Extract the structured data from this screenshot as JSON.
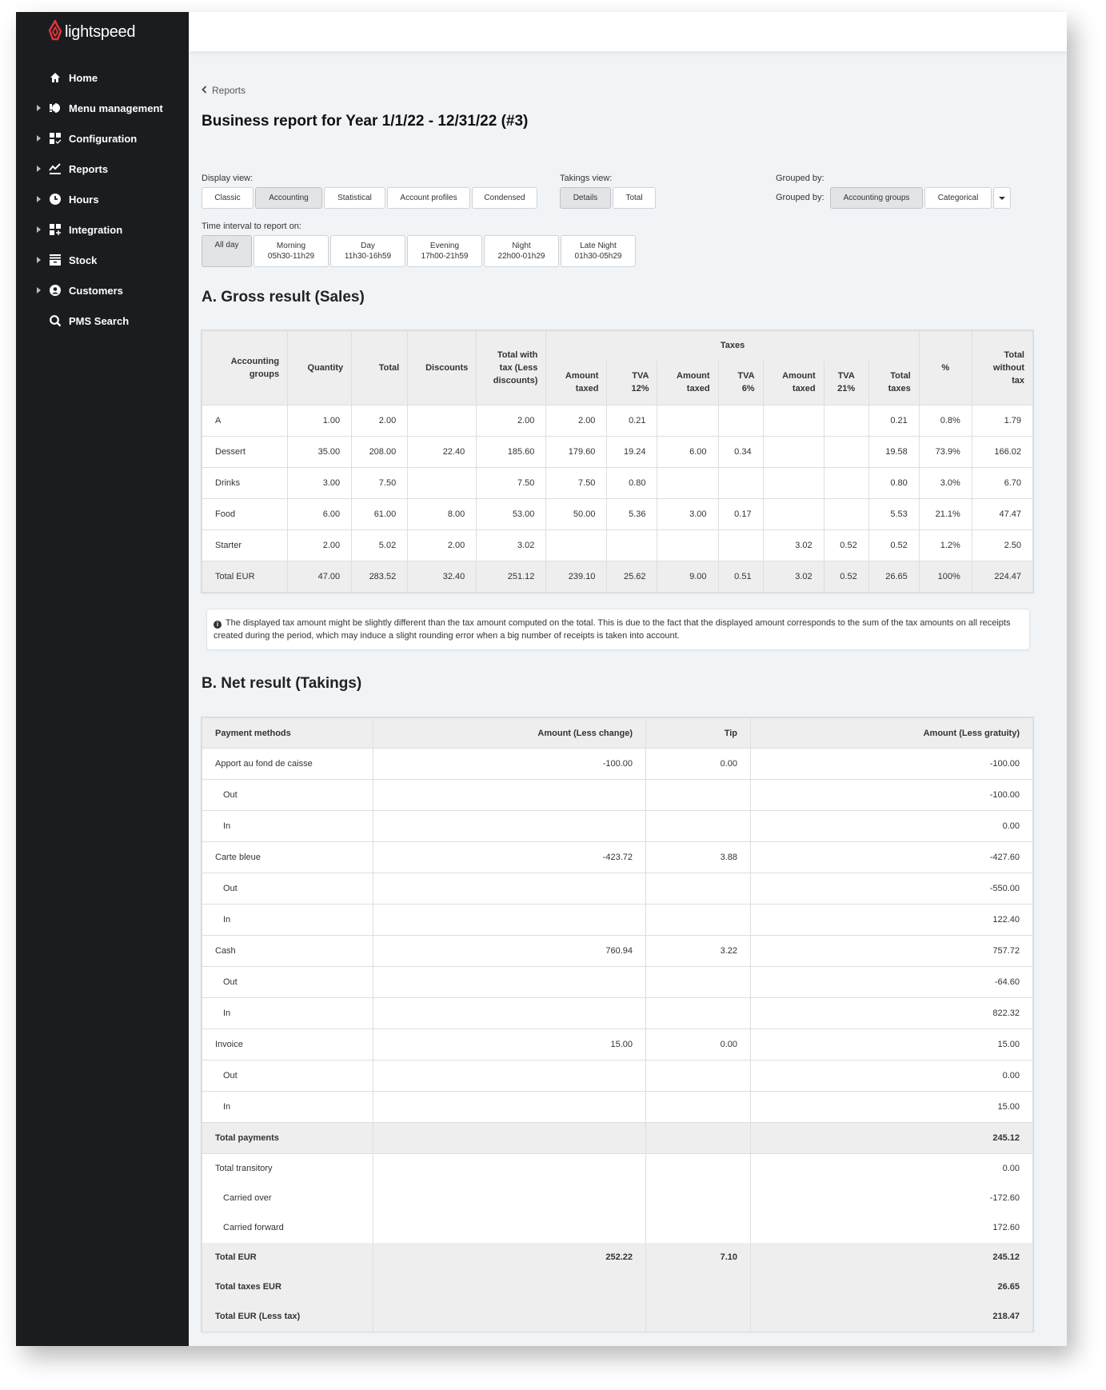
{
  "app": {
    "brand": "lightspeed",
    "brand_color": "#e4343c"
  },
  "sidebar": {
    "items": [
      {
        "label": "Home",
        "icon": "home-icon",
        "expandable": false
      },
      {
        "label": "Menu management",
        "icon": "menu-management-icon",
        "expandable": true
      },
      {
        "label": "Configuration",
        "icon": "configuration-icon",
        "expandable": true
      },
      {
        "label": "Reports",
        "icon": "reports-icon",
        "expandable": true
      },
      {
        "label": "Hours",
        "icon": "clock-icon",
        "expandable": true
      },
      {
        "label": "Integration",
        "icon": "integration-icon",
        "expandable": true
      },
      {
        "label": "Stock",
        "icon": "stock-icon",
        "expandable": true
      },
      {
        "label": "Customers",
        "icon": "user-icon",
        "expandable": true
      },
      {
        "label": "PMS Search",
        "icon": "search-icon",
        "expandable": false
      }
    ]
  },
  "breadcrumb": {
    "back_label": "Reports"
  },
  "page_title": "Business report for Year 1/1/22 - 12/31/22 (#3)",
  "controls": {
    "display_view": {
      "label": "Display view:",
      "options": [
        "Classic",
        "Accounting",
        "Statistical",
        "Account profiles",
        "Condensed"
      ],
      "selected": "Accounting"
    },
    "takings_view": {
      "label": "Takings view:",
      "options": [
        "Details",
        "Total"
      ],
      "selected": "Details"
    },
    "grouped_by": {
      "heading": "Grouped by:",
      "label": "Grouped by:",
      "options": [
        "Accounting groups",
        "Categorical"
      ],
      "selected": "Accounting groups"
    },
    "time_interval": {
      "label": "Time interval to report on:",
      "options": [
        {
          "name": "All day",
          "range": ""
        },
        {
          "name": "Morning",
          "range": "05h30-11h29"
        },
        {
          "name": "Day",
          "range": "11h30-16h59"
        },
        {
          "name": "Evening",
          "range": "17h00-21h59"
        },
        {
          "name": "Night",
          "range": "22h00-01h29"
        },
        {
          "name": "Late Night",
          "range": "01h30-05h29"
        }
      ],
      "selected": "All day"
    }
  },
  "gross": {
    "title": "A. Gross result (Sales)",
    "headers": {
      "group": "Accounting groups",
      "quantity": "Quantity",
      "total": "Total",
      "discounts": "Discounts",
      "total_with_tax": "Total with tax (Less discounts)",
      "taxes": "Taxes",
      "amount_taxed": "Amount taxed",
      "tva12": "TVA 12%",
      "tva6": "TVA 6%",
      "tva21": "TVA 21%",
      "total_taxes": "Total taxes",
      "percent": "%",
      "total_without_tax": "Total without tax"
    },
    "rows": [
      {
        "group": "A",
        "quantity": "1.00",
        "total": "2.00",
        "discounts": "",
        "total_with_tax": "2.00",
        "amt12": "2.00",
        "tva12": "0.21",
        "amt6": "",
        "tva6": "",
        "amt21": "",
        "tva21": "",
        "total_taxes": "0.21",
        "percent": "0.8%",
        "total_without_tax": "1.79"
      },
      {
        "group": "Dessert",
        "quantity": "35.00",
        "total": "208.00",
        "discounts": "22.40",
        "total_with_tax": "185.60",
        "amt12": "179.60",
        "tva12": "19.24",
        "amt6": "6.00",
        "tva6": "0.34",
        "amt21": "",
        "tva21": "",
        "total_taxes": "19.58",
        "percent": "73.9%",
        "total_without_tax": "166.02"
      },
      {
        "group": "Drinks",
        "quantity": "3.00",
        "total": "7.50",
        "discounts": "",
        "total_with_tax": "7.50",
        "amt12": "7.50",
        "tva12": "0.80",
        "amt6": "",
        "tva6": "",
        "amt21": "",
        "tva21": "",
        "total_taxes": "0.80",
        "percent": "3.0%",
        "total_without_tax": "6.70"
      },
      {
        "group": "Food",
        "quantity": "6.00",
        "total": "61.00",
        "discounts": "8.00",
        "total_with_tax": "53.00",
        "amt12": "50.00",
        "tva12": "5.36",
        "amt6": "3.00",
        "tva6": "0.17",
        "amt21": "",
        "tva21": "",
        "total_taxes": "5.53",
        "percent": "21.1%",
        "total_without_tax": "47.47"
      },
      {
        "group": "Starter",
        "quantity": "2.00",
        "total": "5.02",
        "discounts": "2.00",
        "total_with_tax": "3.02",
        "amt12": "",
        "tva12": "",
        "amt6": "",
        "tva6": "",
        "amt21": "3.02",
        "tva21": "0.52",
        "total_taxes": "0.52",
        "percent": "1.2%",
        "total_without_tax": "2.50"
      }
    ],
    "total_row": {
      "group": "Total EUR",
      "quantity": "47.00",
      "total": "283.52",
      "discounts": "32.40",
      "total_with_tax": "251.12",
      "amt12": "239.10",
      "tva12": "25.62",
      "amt6": "9.00",
      "tva6": "0.51",
      "amt21": "3.02",
      "tva21": "0.52",
      "total_taxes": "26.65",
      "percent": "100%",
      "total_without_tax": "224.47"
    },
    "note": "The displayed tax amount might be slightly different than the tax amount computed on the total. This is due to the fact that the displayed amount corresponds to the sum of the tax amounts on all receipts created during the period, which may induce a slight rounding error when a big number of receipts is taken into account."
  },
  "net": {
    "title": "B. Net result (Takings)",
    "headers": {
      "method": "Payment methods",
      "amount": "Amount (Less change)",
      "tip": "Tip",
      "amount_less_gratuity": "Amount (Less gratuity)"
    },
    "rows": [
      {
        "label": "Apport au fond de caisse",
        "amount": "-100.00",
        "tip": "0.00",
        "net": "-100.00",
        "type": "method"
      },
      {
        "label": "Out",
        "amount": "",
        "tip": "",
        "net": "-100.00",
        "type": "sub"
      },
      {
        "label": "In",
        "amount": "",
        "tip": "",
        "net": "0.00",
        "type": "sub"
      },
      {
        "label": "Carte bleue",
        "amount": "-423.72",
        "tip": "3.88",
        "net": "-427.60",
        "type": "method"
      },
      {
        "label": "Out",
        "amount": "",
        "tip": "",
        "net": "-550.00",
        "type": "sub"
      },
      {
        "label": "In",
        "amount": "",
        "tip": "",
        "net": "122.40",
        "type": "sub"
      },
      {
        "label": "Cash",
        "amount": "760.94",
        "tip": "3.22",
        "net": "757.72",
        "type": "method"
      },
      {
        "label": "Out",
        "amount": "",
        "tip": "",
        "net": "-64.60",
        "type": "sub"
      },
      {
        "label": "In",
        "amount": "",
        "tip": "",
        "net": "822.32",
        "type": "sub"
      },
      {
        "label": "Invoice",
        "amount": "15.00",
        "tip": "0.00",
        "net": "15.00",
        "type": "method"
      },
      {
        "label": "Out",
        "amount": "",
        "tip": "",
        "net": "0.00",
        "type": "sub"
      },
      {
        "label": "In",
        "amount": "",
        "tip": "",
        "net": "15.00",
        "type": "sub"
      }
    ],
    "total_payments": {
      "label": "Total payments",
      "amount": "",
      "tip": "",
      "net": "245.12"
    },
    "transitory": [
      {
        "label": "Total transitory",
        "net": "0.00",
        "sub": false
      },
      {
        "label": "Carried over",
        "net": "-172.60",
        "sub": true
      },
      {
        "label": "Carried forward",
        "net": "172.60",
        "sub": true
      }
    ],
    "totals": [
      {
        "label": "Total EUR",
        "amount": "252.22",
        "tip": "7.10",
        "net": "245.12"
      },
      {
        "label": "Total taxes EUR",
        "amount": "",
        "tip": "",
        "net": "26.65"
      },
      {
        "label": "Total EUR (Less tax)",
        "amount": "",
        "tip": "",
        "net": "218.47"
      }
    ]
  }
}
